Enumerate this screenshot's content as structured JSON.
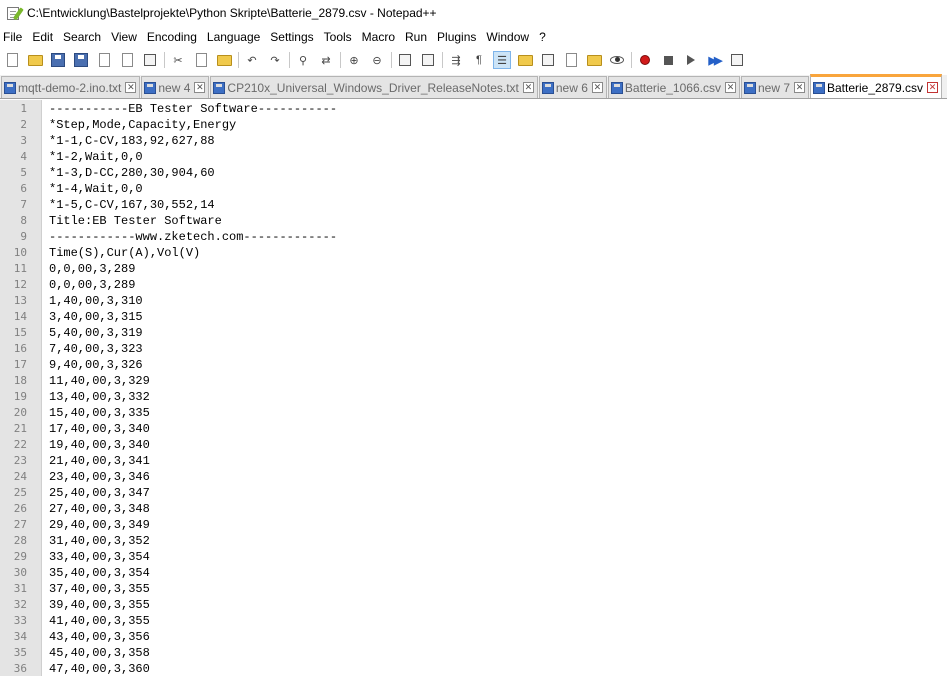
{
  "window": {
    "title": "C:\\Entwicklung\\Bastelprojekte\\Python Skripte\\Batterie_2879.csv - Notepad++"
  },
  "menu": [
    "File",
    "Edit",
    "Search",
    "View",
    "Encoding",
    "Language",
    "Settings",
    "Tools",
    "Macro",
    "Run",
    "Plugins",
    "Window",
    "?"
  ],
  "tabs": [
    {
      "label": "mqtt-demo-2.ino.txt",
      "active": false
    },
    {
      "label": "new 4",
      "active": false
    },
    {
      "label": "CP210x_Universal_Windows_Driver_ReleaseNotes.txt",
      "active": false
    },
    {
      "label": "new 6",
      "active": false
    },
    {
      "label": "Batterie_1066.csv",
      "active": false
    },
    {
      "label": "new 7",
      "active": false
    },
    {
      "label": "Batterie_2879.csv",
      "active": true
    }
  ],
  "editor": {
    "line_numbers": [
      "1",
      "2",
      "3",
      "4",
      "5",
      "6",
      "7",
      "8",
      "9",
      "10",
      "11",
      "12",
      "13",
      "14",
      "15",
      "16",
      "17",
      "18",
      "19",
      "20",
      "21",
      "22",
      "23",
      "24",
      "25",
      "26",
      "27",
      "28",
      "29",
      "30",
      "31",
      "32",
      "33",
      "34",
      "35",
      "36"
    ],
    "lines": [
      "-----------EB Tester Software-----------",
      "*Step,Mode,Capacity,Energy",
      "*1-1,C-CV,183,92,627,88",
      "*1-2,Wait,0,0",
      "*1-3,D-CC,280,30,904,60",
      "*1-4,Wait,0,0",
      "*1-5,C-CV,167,30,552,14",
      "Title:EB Tester Software",
      "------------www.zketech.com-------------",
      "Time(S),Cur(A),Vol(V)",
      "0,0,00,3,289",
      "0,0,00,3,289",
      "1,40,00,3,310",
      "3,40,00,3,315",
      "5,40,00,3,319",
      "7,40,00,3,323",
      "9,40,00,3,326",
      "11,40,00,3,329",
      "13,40,00,3,332",
      "15,40,00,3,335",
      "17,40,00,3,340",
      "19,40,00,3,340",
      "21,40,00,3,341",
      "23,40,00,3,346",
      "25,40,00,3,347",
      "27,40,00,3,348",
      "29,40,00,3,349",
      "31,40,00,3,352",
      "33,40,00,3,354",
      "35,40,00,3,354",
      "37,40,00,3,355",
      "39,40,00,3,355",
      "41,40,00,3,355",
      "43,40,00,3,356",
      "45,40,00,3,358",
      "47,40,00,3,360"
    ]
  },
  "colors": {
    "active_tab_accent": "#f9a53c",
    "gutter_bg": "#e4e4e4",
    "line_number": "#808080"
  }
}
